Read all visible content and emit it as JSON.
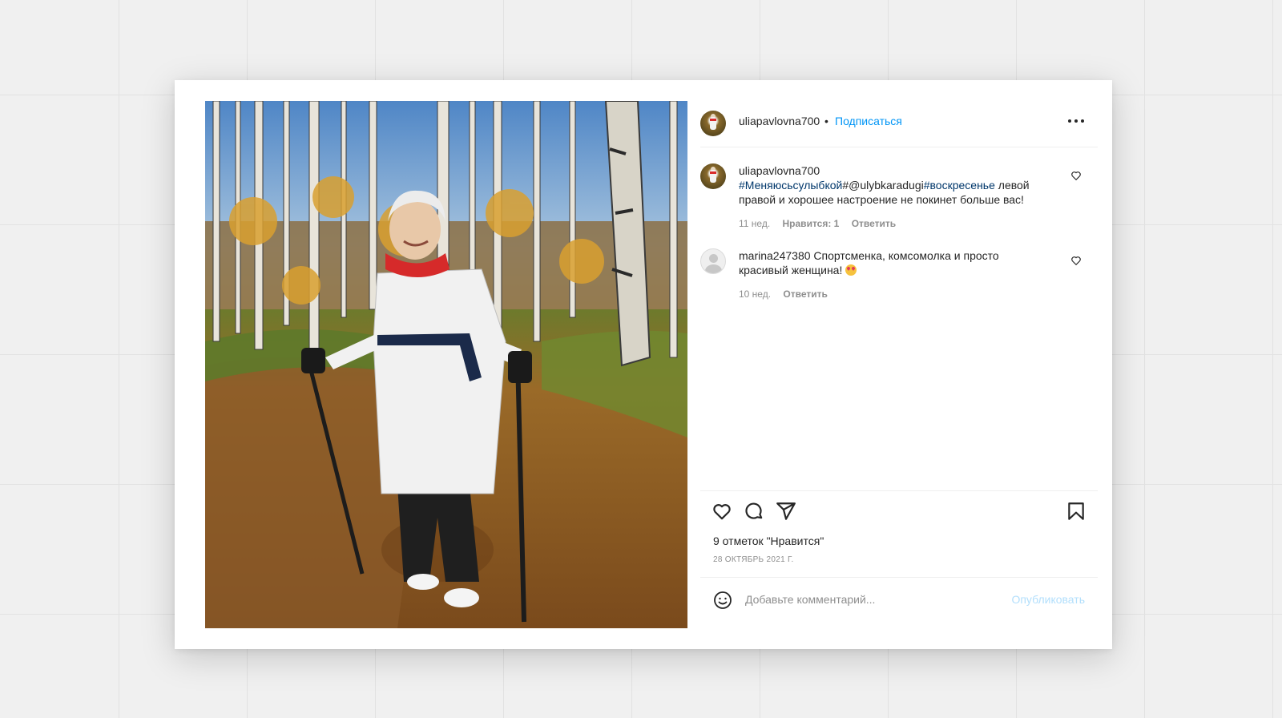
{
  "post": {
    "author": "uliapavlovna700",
    "separator": "•",
    "follow_label": "Подписаться"
  },
  "caption": {
    "user": "uliapavlovna700",
    "tags": [
      "#Меняюсьсулыбкой",
      "#@ulybkaradugi",
      "#воскресенье"
    ],
    "text": " левой правой и хорошее настроение не покинет больше вас!",
    "time": "11 нед.",
    "likes": "Нравится: 1",
    "reply": "Ответить"
  },
  "comment": {
    "user": "marina247380",
    "text": " Спортсменка, комсомолка и просто красивый женщина! ",
    "emoji": "smiling-face-with-heart-eyes",
    "time": "10 нед.",
    "reply": "Ответить"
  },
  "actions": {
    "likes_count": "9 отметок \"Нравится\"",
    "date": "28 ОКТЯБРЬ 2021 Г."
  },
  "add_comment": {
    "placeholder": "Добавьте комментарий...",
    "publish_label": "Опубликовать"
  },
  "icons": {
    "like": "heart-icon",
    "comment": "comment-bubble-icon",
    "share": "paper-plane-icon",
    "save": "bookmark-icon",
    "more": "more-dots-icon",
    "emoji": "smiley-icon"
  },
  "colors": {
    "link_blue": "#0095f6",
    "hashtag": "#00376b",
    "muted": "#8e8e8e",
    "publish_disabled": "#b2dffc"
  }
}
